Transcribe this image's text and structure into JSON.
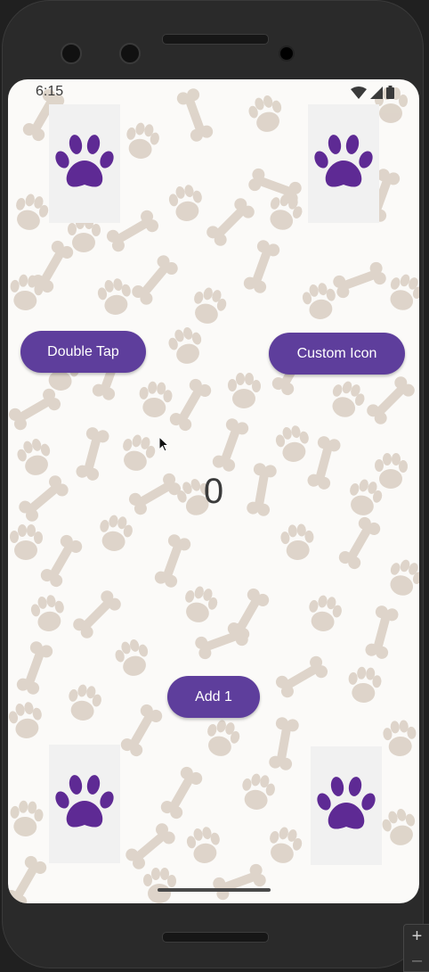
{
  "status_bar": {
    "time": "6:15",
    "icons": [
      "wifi-icon",
      "cellular-signal-icon",
      "battery-icon"
    ]
  },
  "paw_cards": [
    {
      "position": "top-left",
      "icon": "paw-icon"
    },
    {
      "position": "top-right",
      "icon": "paw-icon"
    },
    {
      "position": "bottom-left",
      "icon": "paw-icon"
    },
    {
      "position": "bottom-right",
      "icon": "paw-icon"
    }
  ],
  "buttons": {
    "double_tap": "Double Tap",
    "custom_icon": "Custom Icon",
    "add_one": "Add 1"
  },
  "counter": {
    "value": "0"
  },
  "emulator": {
    "zoom_in": "+",
    "zoom_out": "–"
  },
  "colors": {
    "button_bg": "#5e3e9c",
    "paw_icon": "#5e2a94",
    "pattern": "#ddd3c8",
    "card_bg": "#f1f1f1"
  }
}
